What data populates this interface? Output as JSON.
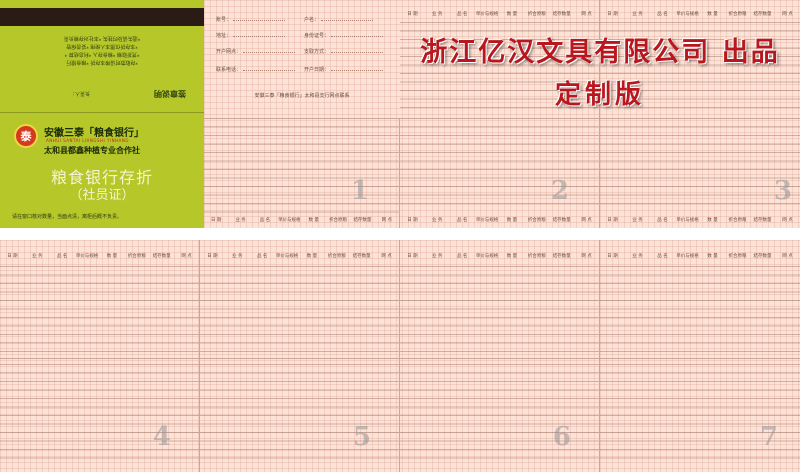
{
  "cover": {
    "back_text_lines": [
      "*存取款时请带本存折 *粮食银行",
      "*凭折取粮 *粮食存入 *利息结算 *",
      "*本存折仅限本人使用 *妥善保管",
      "*遗失请及时挂失 *本社对存粮负责"
    ],
    "back_sign_small": "负责人：",
    "back_sign_bold": "签章说明",
    "org_name": "安徽三泰「粮食银行」",
    "org_pinyin": "ANHUI SANTAI LIANGSHI YINHANG",
    "org_sub": "太和县都鑫种植专业合作社",
    "logo_char": "泰",
    "book_title": "粮食银行存折",
    "book_subtitle": "（社员证）",
    "note": "请在窗口核对数量，当面点清，离柜后概不负责。"
  },
  "info": {
    "account_label": "账号：",
    "holder_label": "户名：",
    "id_label": "地址：",
    "idno_label": "身份证号：",
    "open_date_label": "开户网点：",
    "pay_label": "支取方式：",
    "phone_label": "联系电话：",
    "open_label": "开户日期：",
    "footer": "安徽三泰「粮食银行」太和县支行网点联系"
  },
  "watermark": {
    "line1": "浙江亿汉文具有限公司 出品",
    "line2": "定制版"
  },
  "ledger_headers": [
    "日 期",
    "业 务",
    "品 名",
    "单价与规格",
    "数 量",
    "折合原粮",
    "结存数量",
    "网 点"
  ],
  "page_numbers": [
    "1",
    "2",
    "3",
    "4",
    "5",
    "6",
    "7"
  ],
  "colors": {
    "cover_green": "#b6c72a",
    "paper_pink": "#fbe3d8",
    "watermark_red": "#b9171d",
    "stripe": "#2a1b14"
  }
}
